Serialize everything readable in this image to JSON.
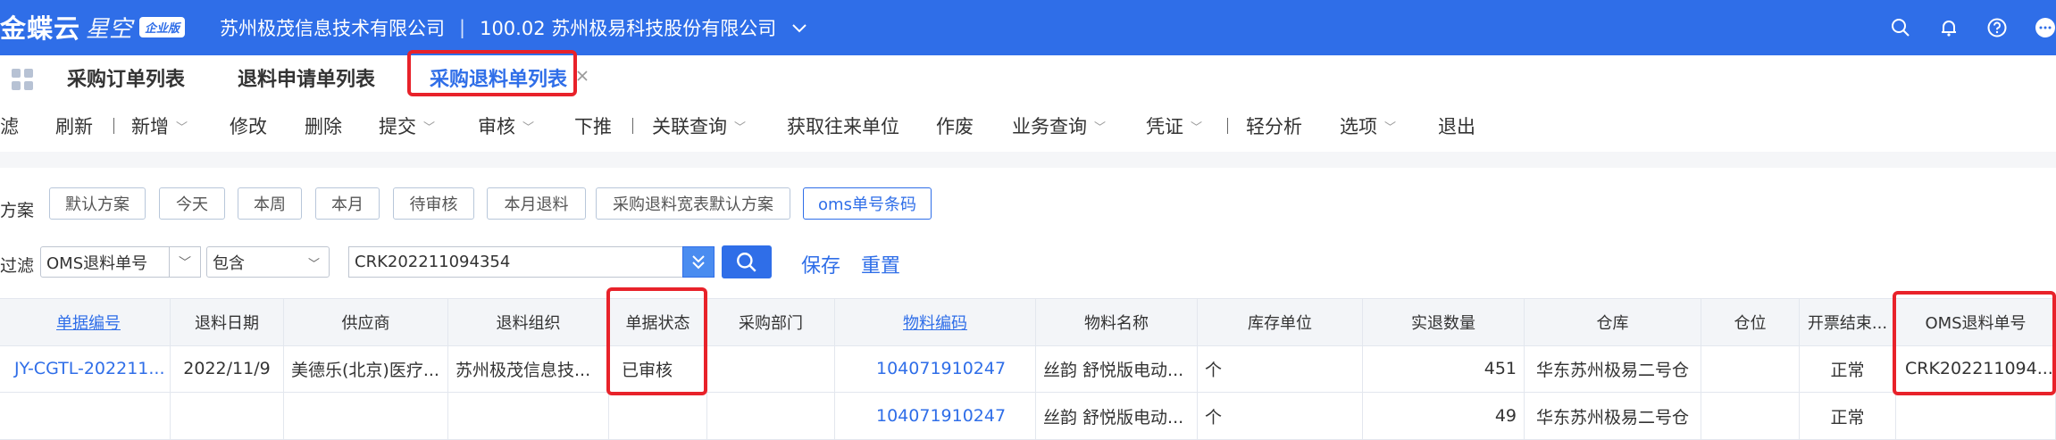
{
  "header": {
    "brand": "金蝶云",
    "brand_sub": "星空",
    "edition": "企业版",
    "company": "苏州极茂信息技术有限公司",
    "separator": "|",
    "org": "100.02 苏州极易科技股份有限公司"
  },
  "tabs": [
    {
      "label": "采购订单列表"
    },
    {
      "label": "退料申请单列表"
    },
    {
      "label": "采购退料单列表"
    }
  ],
  "toolbar": {
    "filter": "滤",
    "refresh": "刷新",
    "new": "新增",
    "modify": "修改",
    "delete": "删除",
    "submit": "提交",
    "audit": "审核",
    "push": "下推",
    "linked_query": "关联查询",
    "get_partner": "获取往来单位",
    "void": "作废",
    "biz_query": "业务查询",
    "voucher": "凭证",
    "light_analysis": "轻分析",
    "options": "选项",
    "exit": "退出",
    "pipe": "|"
  },
  "scheme": {
    "label": "方案",
    "chips": [
      "默认方案",
      "今天",
      "本周",
      "本月",
      "待审核",
      "本月退料",
      "采购退料宽表默认方案",
      "oms单号条码"
    ]
  },
  "filter": {
    "label": "过滤",
    "field": "OMS退料单号",
    "operator": "包含",
    "value": "CRK202211094354",
    "save": "保存",
    "reset": "重置"
  },
  "table": {
    "headers": [
      "单据编号",
      "退料日期",
      "供应商",
      "退料组织",
      "单据状态",
      "采购部门",
      "物料编码",
      "物料名称",
      "库存单位",
      "实退数量",
      "仓库",
      "仓位",
      "开票结束...",
      "OMS退料单号"
    ],
    "rows": [
      [
        "JY-CGTL-202211...",
        "2022/11/9",
        "美德乐(北京)医疗...",
        "苏州极茂信息技...",
        "已审核",
        "",
        "104071910247",
        "丝韵 舒悦版电动...",
        "个",
        "451",
        "华东苏州极易二号仓",
        "",
        "正常",
        "CRK202211094..."
      ],
      [
        "",
        "",
        "",
        "",
        "",
        "",
        "104071910247",
        "丝韵 舒悦版电动...",
        "个",
        "49",
        "华东苏州极易二号仓",
        "",
        "正常",
        ""
      ]
    ]
  },
  "colors": {
    "primary": "#2f6ee8",
    "highlight": "#e8222a"
  }
}
